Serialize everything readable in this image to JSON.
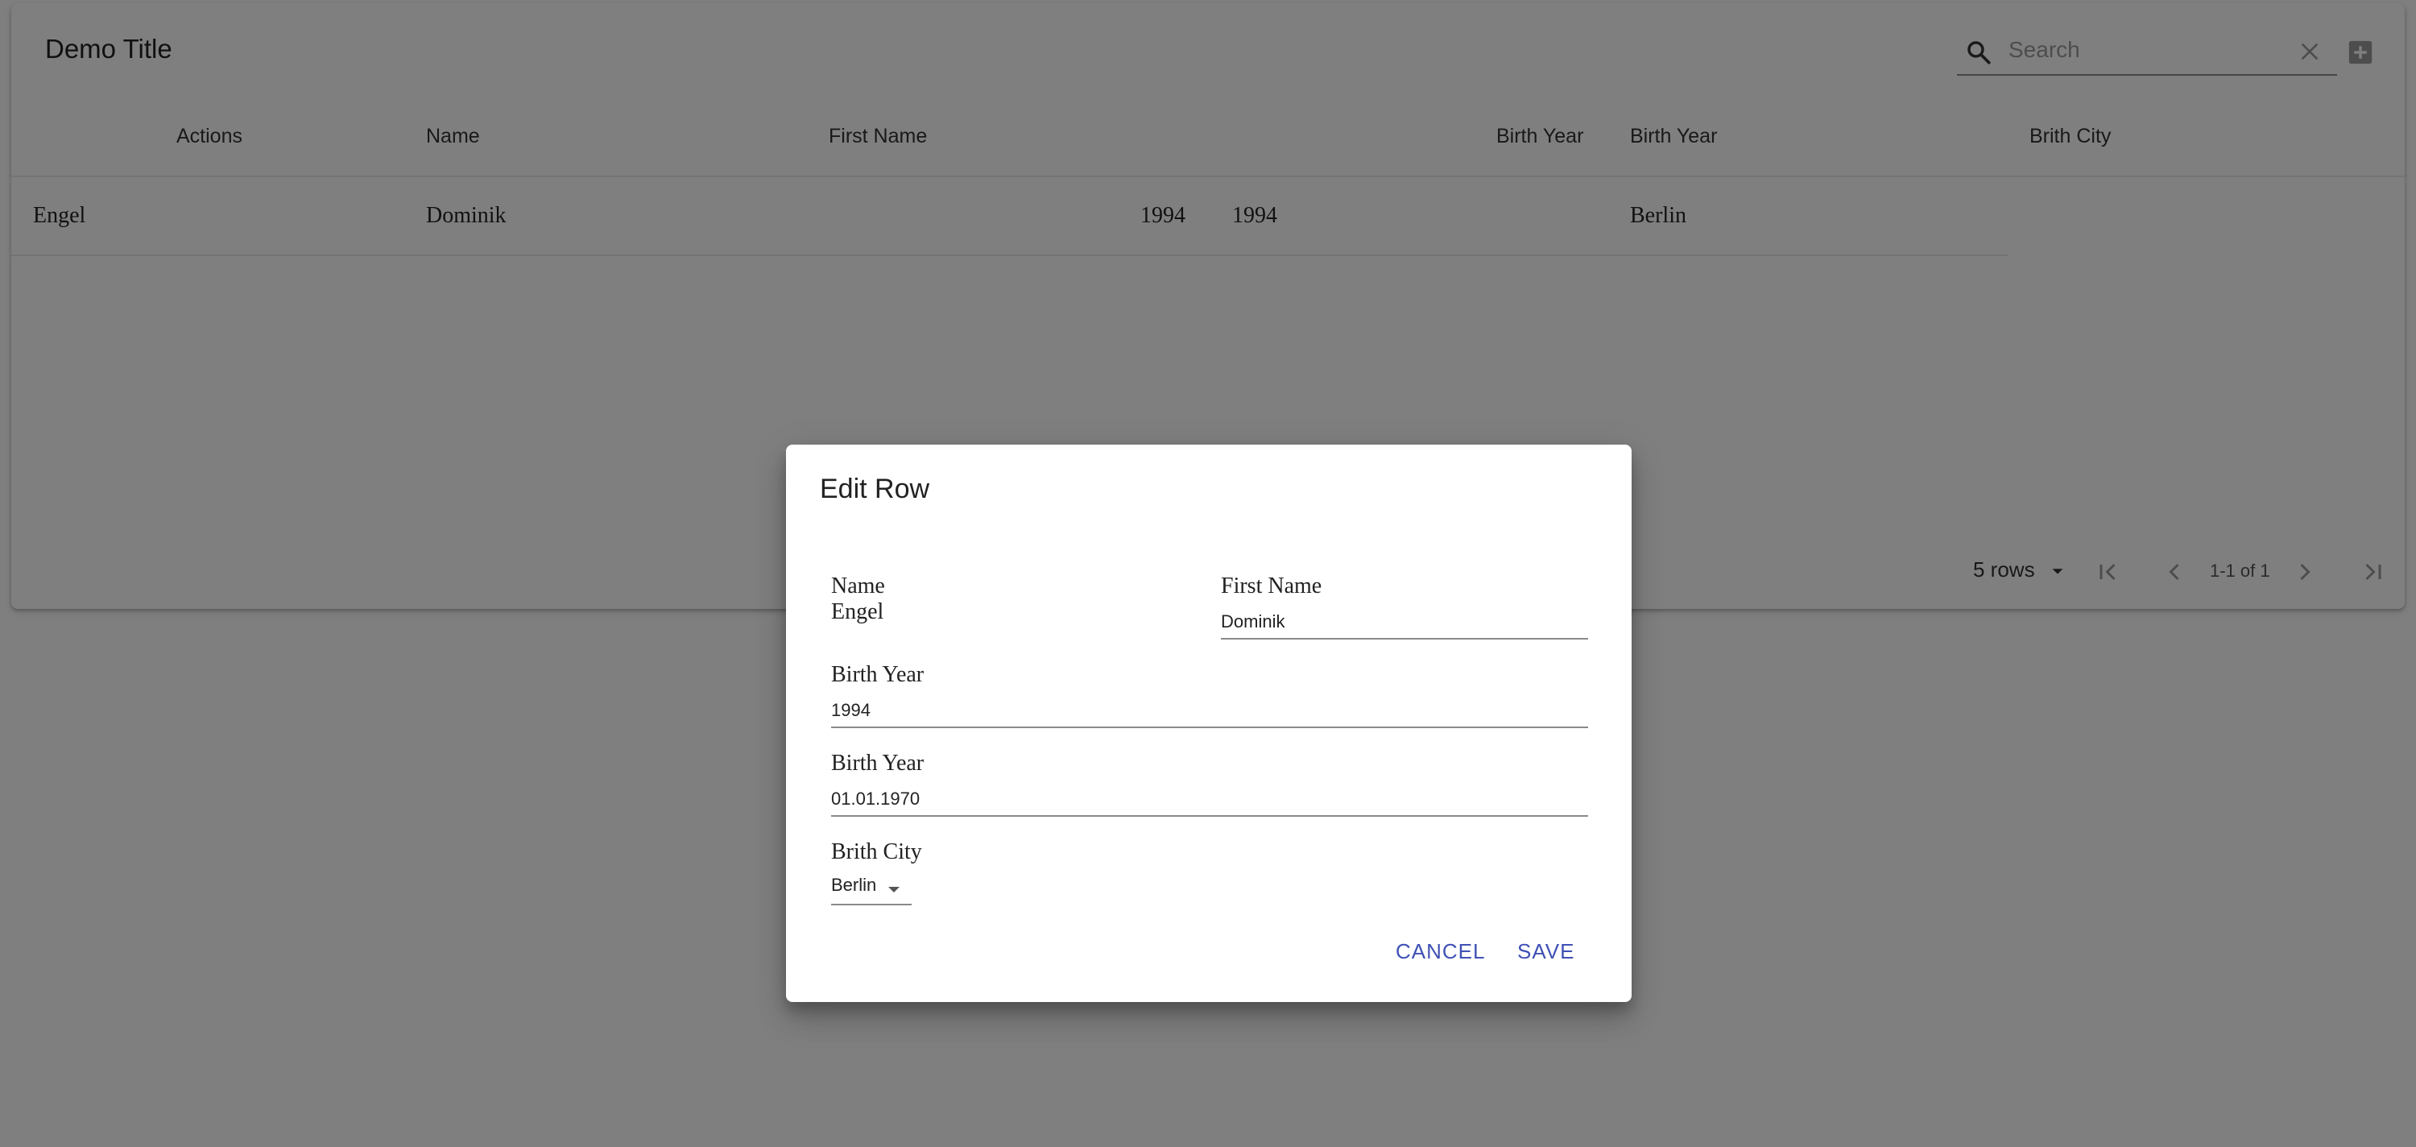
{
  "table": {
    "title": "Demo Title",
    "search_placeholder": "Search",
    "columns": [
      "Actions",
      "Name",
      "First Name",
      "Birth Year",
      "Birth Year",
      "Brith City"
    ],
    "rows": [
      {
        "name": "Engel",
        "first_name": "Dominik",
        "birth_year": "1994",
        "birth_year_2": "1994",
        "birth_city": "Berlin"
      }
    ],
    "pagination": {
      "rows_per_page": "5 rows",
      "range": "1-1 of 1"
    }
  },
  "dialog": {
    "title": "Edit Row",
    "fields": {
      "name": {
        "label": "Name",
        "value": "Engel"
      },
      "first_name": {
        "label": "First Name",
        "value": "Dominik"
      },
      "birth_year": {
        "label": "Birth Year",
        "value": "1994"
      },
      "birth_date": {
        "label": "Birth Year",
        "value": "01.01.1970"
      },
      "birth_city": {
        "label": "Brith City",
        "value": "Berlin"
      }
    },
    "cancel_label": "CANCEL",
    "save_label": "SAVE"
  },
  "colors": {
    "accent": "#3f51b5",
    "overlay": "rgba(0,0,0,0.5)"
  }
}
